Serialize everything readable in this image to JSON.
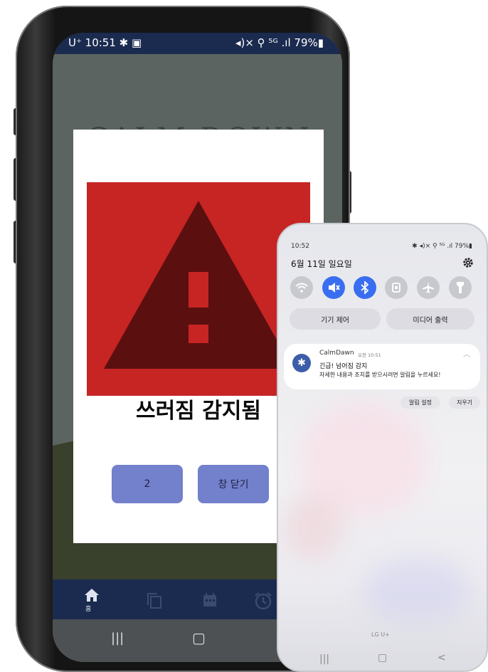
{
  "phone1": {
    "status_bar": {
      "time_left": "U⁺ 10:51 ✱ ▣",
      "right": "◂)× ⚲ ⁵ᴳ .ıl 79%▮"
    },
    "background_title": "CALM DOWN",
    "dialog": {
      "warning_title": "쓰러짐 감지됨",
      "countdown_button": "2",
      "close_button": "창 닫기"
    },
    "bottom_nav": {
      "home_label": "홈",
      "items": [
        "home-icon",
        "copy-icon",
        "calendar-icon",
        "alarm-icon"
      ]
    },
    "gesture_bar": [
      "|||",
      "▢",
      "<"
    ]
  },
  "phone2": {
    "status_bar": {
      "time": "10:52",
      "right": "✱ ◂)× ⚲ ⁵ᴳ .ıl 79%▮"
    },
    "date": "6월 11일 일요일",
    "quick_settings": {
      "toggles": [
        "wifi-icon",
        "mute-icon",
        "bluetooth-icon",
        "lock-rotation-icon",
        "airplane-icon",
        "flashlight-icon"
      ],
      "device_control": "기기 제어",
      "media_output": "미디어 출력"
    },
    "notification": {
      "app": "CalmDawn",
      "time": "오전 10:51",
      "title": "긴급! 넘어짐 감지",
      "body": "자세한 내용과 조치를 받으시려면 알림을 누르세요!"
    },
    "actions": {
      "notification_settings": "알림 설정",
      "clear": "지우기"
    },
    "carrier": "LG U+",
    "gesture_bar": [
      "|||",
      "▢",
      "<"
    ]
  },
  "colors": {
    "status_bar_navy": "#1b2b50",
    "warning_red": "#c72424",
    "warning_dark": "#5c0f0f",
    "button_purple": "#7380cc",
    "toggle_blue": "#3a6ef0"
  }
}
